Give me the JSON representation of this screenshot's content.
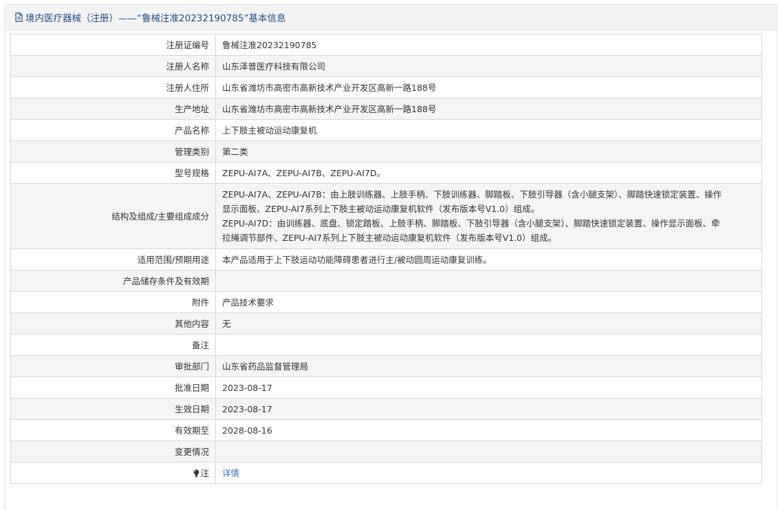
{
  "header": {
    "title": "境内医疗器械（注册）——“鲁械注准20232190785”基本信息"
  },
  "rows": [
    {
      "label": "注册证编号",
      "value": "鲁械注准20232190785"
    },
    {
      "label": "注册人名称",
      "value": "山东泽普医疗科技有限公司"
    },
    {
      "label": "注册人住所",
      "value": "山东省潍坊市高密市高新技术产业开发区高新一路188号"
    },
    {
      "label": "生产地址",
      "value": "山东省潍坊市高密市高新技术产业开发区高新一路188号"
    },
    {
      "label": "产品名称",
      "value": "上下肢主被动运动康复机"
    },
    {
      "label": "管理类别",
      "value": "第二类"
    },
    {
      "label": "型号规格",
      "value": "ZEPU-AI7A、ZEPU-AI7B、ZEPU-AI7D。"
    },
    {
      "label": "结构及组成/主要组成成分",
      "value_lines": [
        "ZEPU-AI7A、ZEPU-AI7B：由上肢训练器、上肢手柄、下肢训练器、脚踏板、下肢引导器（含小腿支架）、脚踏快速锁定装置、操作",
        "显示面板、ZEPU-AI7系列上下肢主被动运动康复机软件（发布版本号V1.0）组成。",
        "ZEPU-AI7D：由训练器、底盘、锁定踏板、上肢手柄、脚踏板、下肢引导器（含小腿支架）、脚踏快速锁定装置、操作显示面板、牵",
        "拉绳调节部件、ZEPU-AI7系列上下肢主被动运动康复机软件（发布版本号V1.0）组成。"
      ]
    },
    {
      "label": "适用范围/预期用途",
      "value": "本产品适用于上下肢运动功能障碍患者进行主/被动圆周运动康复训练。"
    },
    {
      "label": "产品储存条件及有效期",
      "value": ""
    },
    {
      "label": "附件",
      "value": "产品技术要求"
    },
    {
      "label": "其他内容",
      "value": "无"
    },
    {
      "label": "备注",
      "value": ""
    },
    {
      "label": "审批部门",
      "value": "山东省药品监督管理局"
    },
    {
      "label": "批准日期",
      "value": "2023-08-17"
    },
    {
      "label": "生效日期",
      "value": "2023-08-17"
    },
    {
      "label": "有效期至",
      "value": "2028-08-16"
    },
    {
      "label": "变更情况",
      "value": ""
    },
    {
      "label": "注",
      "value": "详情",
      "icon": "lightbulb-icon"
    }
  ],
  "colors": {
    "header_text": "#1f4e8c",
    "link": "#2d6fc5",
    "alt_row": "#f5f5f5",
    "border": "#d6d6d6"
  }
}
